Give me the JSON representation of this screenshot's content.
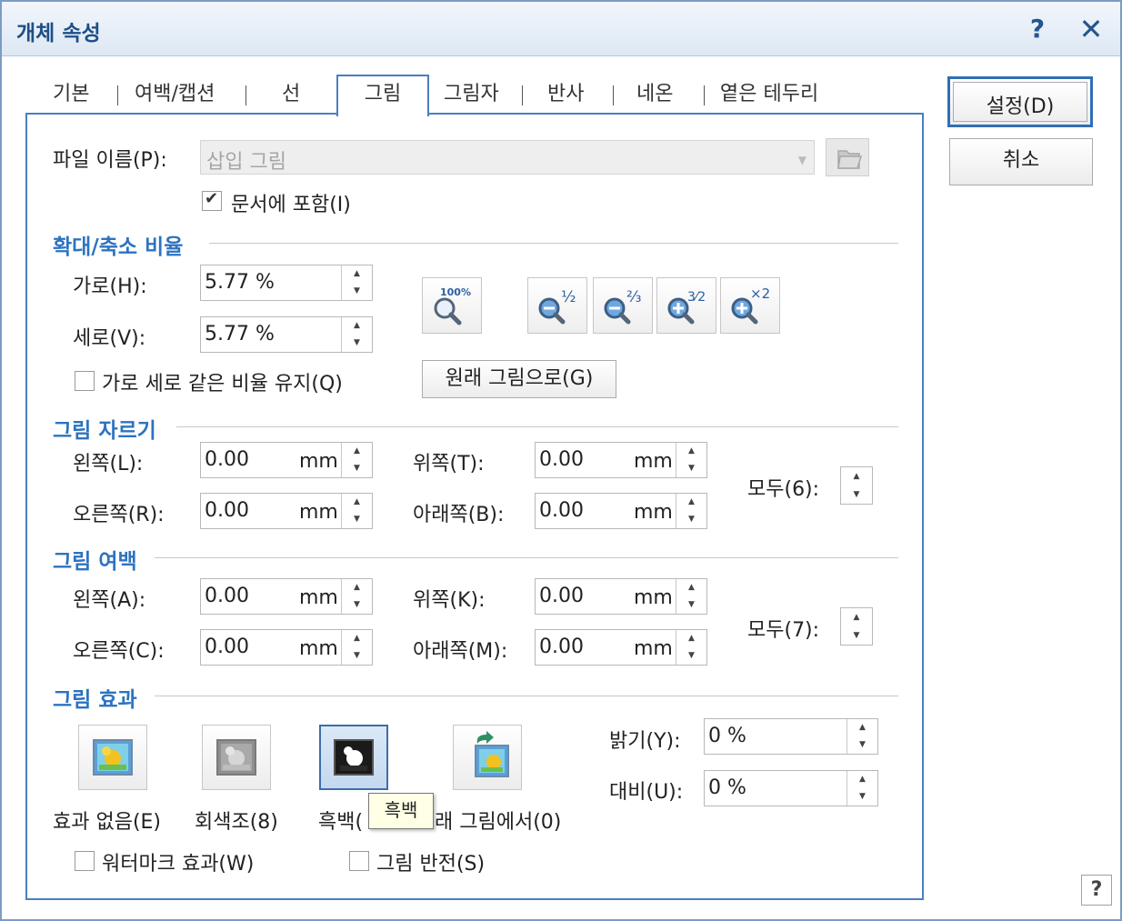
{
  "window": {
    "title": "개체 속성",
    "help_glyph": "?",
    "close_glyph": "✕"
  },
  "tabs": [
    {
      "label": "기본"
    },
    {
      "label": "여백/캡션"
    },
    {
      "label": "선"
    },
    {
      "label": "그림",
      "active": true
    },
    {
      "label": "그림자"
    },
    {
      "label": "반사"
    },
    {
      "label": "네온"
    },
    {
      "label": "옅은 테두리"
    }
  ],
  "file": {
    "label": "파일 이름(P):",
    "value": "삽입 그림",
    "embed_label": "문서에 포함(I)",
    "embed_checked": true
  },
  "scale": {
    "section": "확대/축소 비율",
    "width_label": "가로(H):",
    "width_value": "5.77 %",
    "height_label": "세로(V):",
    "height_value": "5.77 %",
    "keep_ratio_label": "가로 세로 같은 비율 유지(Q)",
    "keep_ratio_checked": false,
    "original_button": "원래 그림으로(G)",
    "zoom_labels": {
      "z100": "100%",
      "half": "½",
      "twothirds": "⅔",
      "threehalves": "3⁄2",
      "double": "×2"
    }
  },
  "crop": {
    "section": "그림 자르기",
    "left_label": "왼쪽(L):",
    "left_value": "0.00",
    "right_label": "오른쪽(R):",
    "right_value": "0.00",
    "top_label": "위쪽(T):",
    "top_value": "0.00",
    "bottom_label": "아래쪽(B):",
    "bottom_value": "0.00",
    "unit": "mm",
    "all_label": "모두(6):"
  },
  "margin": {
    "section": "그림 여백",
    "left_label": "왼쪽(A):",
    "left_value": "0.00",
    "right_label": "오른쪽(C):",
    "right_value": "0.00",
    "top_label": "위쪽(K):",
    "top_value": "0.00",
    "bottom_label": "아래쪽(M):",
    "bottom_value": "0.00",
    "unit": "mm",
    "all_label": "모두(7):"
  },
  "effects": {
    "section": "그림 효과",
    "none_label": "효과 없음(E)",
    "gray_label": "회색조(8)",
    "bw_label": "흑백(",
    "original_label_tail": "래 그림에서(0)",
    "tooltip": "흑백",
    "brightness_label": "밝기(Y):",
    "brightness_value": "0 %",
    "contrast_label": "대비(U):",
    "contrast_value": "0 %",
    "watermark_label": "워터마크 효과(W)",
    "watermark_checked": false,
    "invert_label": "그림 반전(S)",
    "invert_checked": false
  },
  "buttons": {
    "ok": "설정(D)",
    "cancel": "취소",
    "help": "?"
  },
  "colors": {
    "accent": "#2d73c0",
    "title": "#1d4f86",
    "border": "#4a7fc0"
  }
}
